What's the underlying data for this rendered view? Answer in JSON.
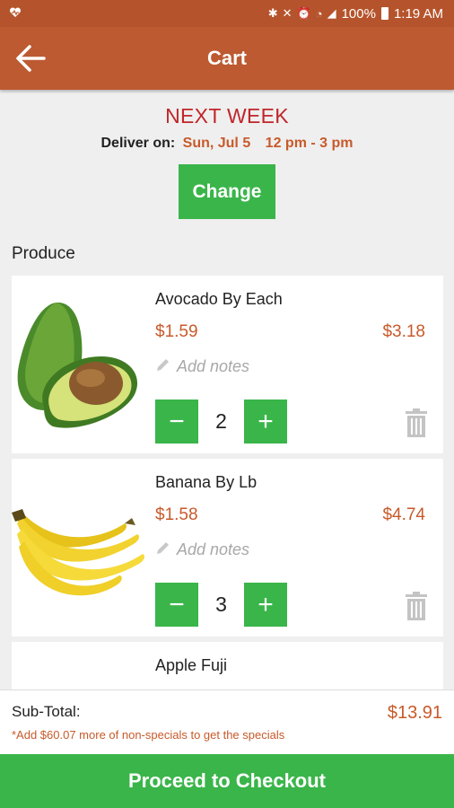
{
  "status_bar": {
    "time": "1:19 AM",
    "battery": "100%"
  },
  "header": {
    "title": "Cart"
  },
  "delivery": {
    "heading": "NEXT WEEK",
    "label": "Deliver on:",
    "date": "Sun, Jul 5",
    "window": "12 pm - 3 pm",
    "change_label": "Change"
  },
  "section": {
    "title": "Produce"
  },
  "items": [
    {
      "name": "Avocado By Each",
      "unit_price": "$1.59",
      "total": "$3.18",
      "notes_placeholder": "Add notes",
      "qty": "2"
    },
    {
      "name": "Banana By Lb",
      "unit_price": "$1.58",
      "total": "$4.74",
      "notes_placeholder": "Add notes",
      "qty": "3"
    },
    {
      "name": "Apple Fuji"
    }
  ],
  "summary": {
    "subtotal_label": "Sub-Total:",
    "subtotal_value": "$13.91",
    "notice": "*Add $60.07 more of non-specials to get the specials"
  },
  "checkout": {
    "label": "Proceed to Checkout"
  },
  "colors": {
    "header": "#bd5a31",
    "accent_green": "#3ab54a",
    "price": "#c85a2a",
    "heading_red": "#c0262a"
  }
}
